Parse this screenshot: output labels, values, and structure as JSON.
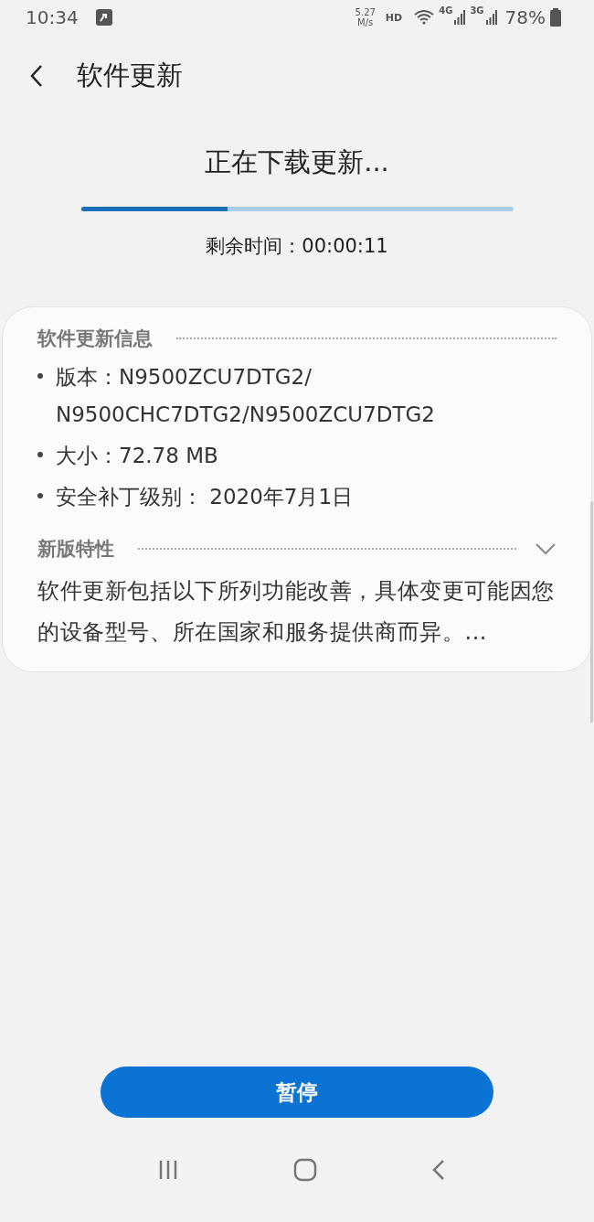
{
  "status_bar": {
    "time": "10:34",
    "speed_value": "5.27",
    "speed_unit": "M/s",
    "hd": "HD",
    "network_1": "4G",
    "network_2": "3G",
    "battery": "78%"
  },
  "header": {
    "title": "软件更新"
  },
  "download": {
    "title": "正在下载更新...",
    "level": 0.34,
    "remaining": "剩余时间：00:00:11"
  },
  "info": {
    "heading": "软件更新信息",
    "items": [
      "版本：N9500ZCU7DTG2/\nN9500CHC7DTG2/N9500ZCU7DTG2",
      "大小：72.78 MB",
      "安全补丁级别： 2020年7月1日"
    ]
  },
  "features": {
    "heading": "新版特性",
    "expanded": false,
    "text": "软件更新包括以下所列功能改善，具体变更可能因您的设备型号、所在国家和服务提供商而异。..."
  },
  "button": {
    "label": "暂停"
  }
}
